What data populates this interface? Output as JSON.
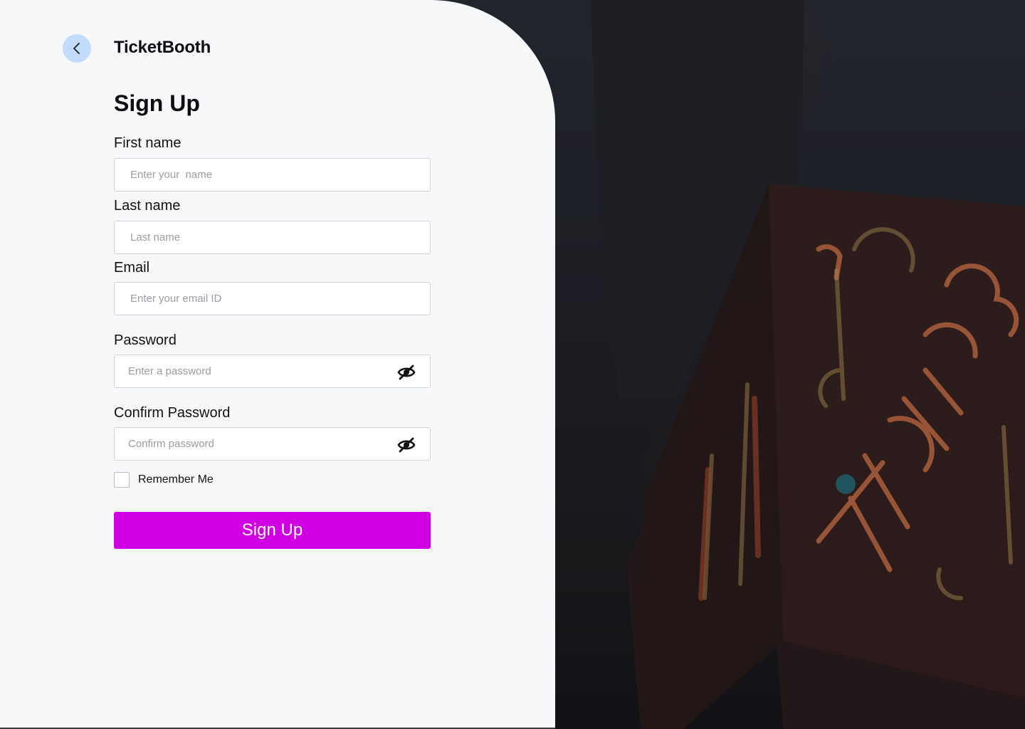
{
  "brand": {
    "name": "TicketBooth"
  },
  "form": {
    "title": "Sign Up",
    "first_name": {
      "label": "First name",
      "placeholder": "Enter your  name"
    },
    "last_name": {
      "label": "Last name",
      "placeholder": "Last name"
    },
    "email": {
      "label": "Email",
      "placeholder": "Enter your email ID"
    },
    "password": {
      "label": "Password",
      "placeholder": "Enter a password"
    },
    "confirm_password": {
      "label": "Confirm Password",
      "placeholder": "Confirm password"
    },
    "remember_label": "Remember Me",
    "remember_checked": false,
    "submit_label": "Sign Up"
  },
  "icons": {
    "back": "chevron-left-icon",
    "password_visibility": "eye-off-icon"
  },
  "colors": {
    "accent": "#cf00e2",
    "back_button_bg": "#c3dcfb",
    "panel_bg": "#f7f8fa"
  },
  "background_image": "neon-tickets-sign-photo"
}
